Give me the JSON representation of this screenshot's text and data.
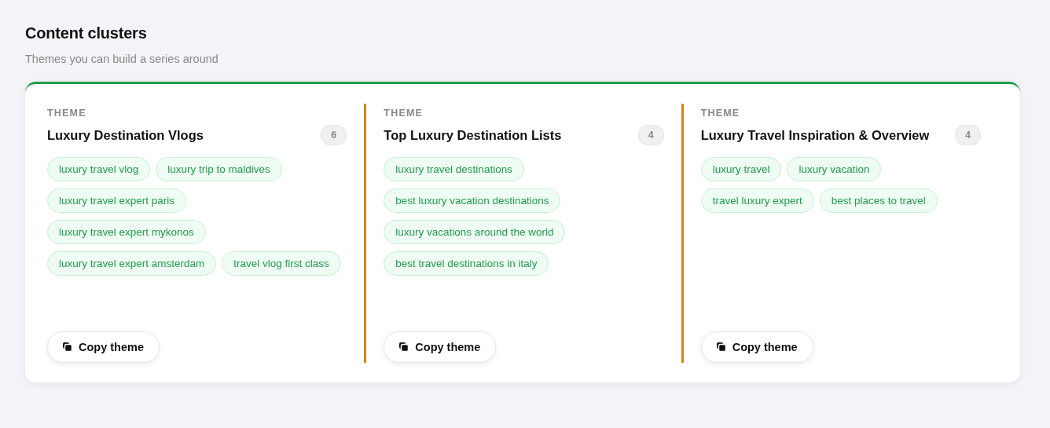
{
  "header": {
    "title": "Content clusters",
    "subtitle": "Themes you can build a series around"
  },
  "themes": [
    {
      "eyebrow": "THEME",
      "name": "Luxury Destination Vlogs",
      "count": "6",
      "keywords": [
        "luxury travel vlog",
        "luxury trip to maldives",
        "luxury travel expert paris",
        "luxury travel expert mykonos",
        "luxury travel expert amsterdam",
        "travel vlog first class"
      ],
      "button": "Copy theme"
    },
    {
      "eyebrow": "THEME",
      "name": "Top Luxury Destination Lists",
      "count": "4",
      "keywords": [
        "luxury travel destinations",
        "best luxury vacation destinations",
        "luxury vacations around the world",
        "best travel destinations in italy"
      ],
      "button": "Copy theme"
    },
    {
      "eyebrow": "THEME",
      "name": "Luxury Travel Inspiration & Overview",
      "count": "4",
      "keywords": [
        "luxury travel",
        "luxury vacation",
        "travel luxury expert",
        "best places to travel"
      ],
      "button": "Copy theme"
    }
  ]
}
